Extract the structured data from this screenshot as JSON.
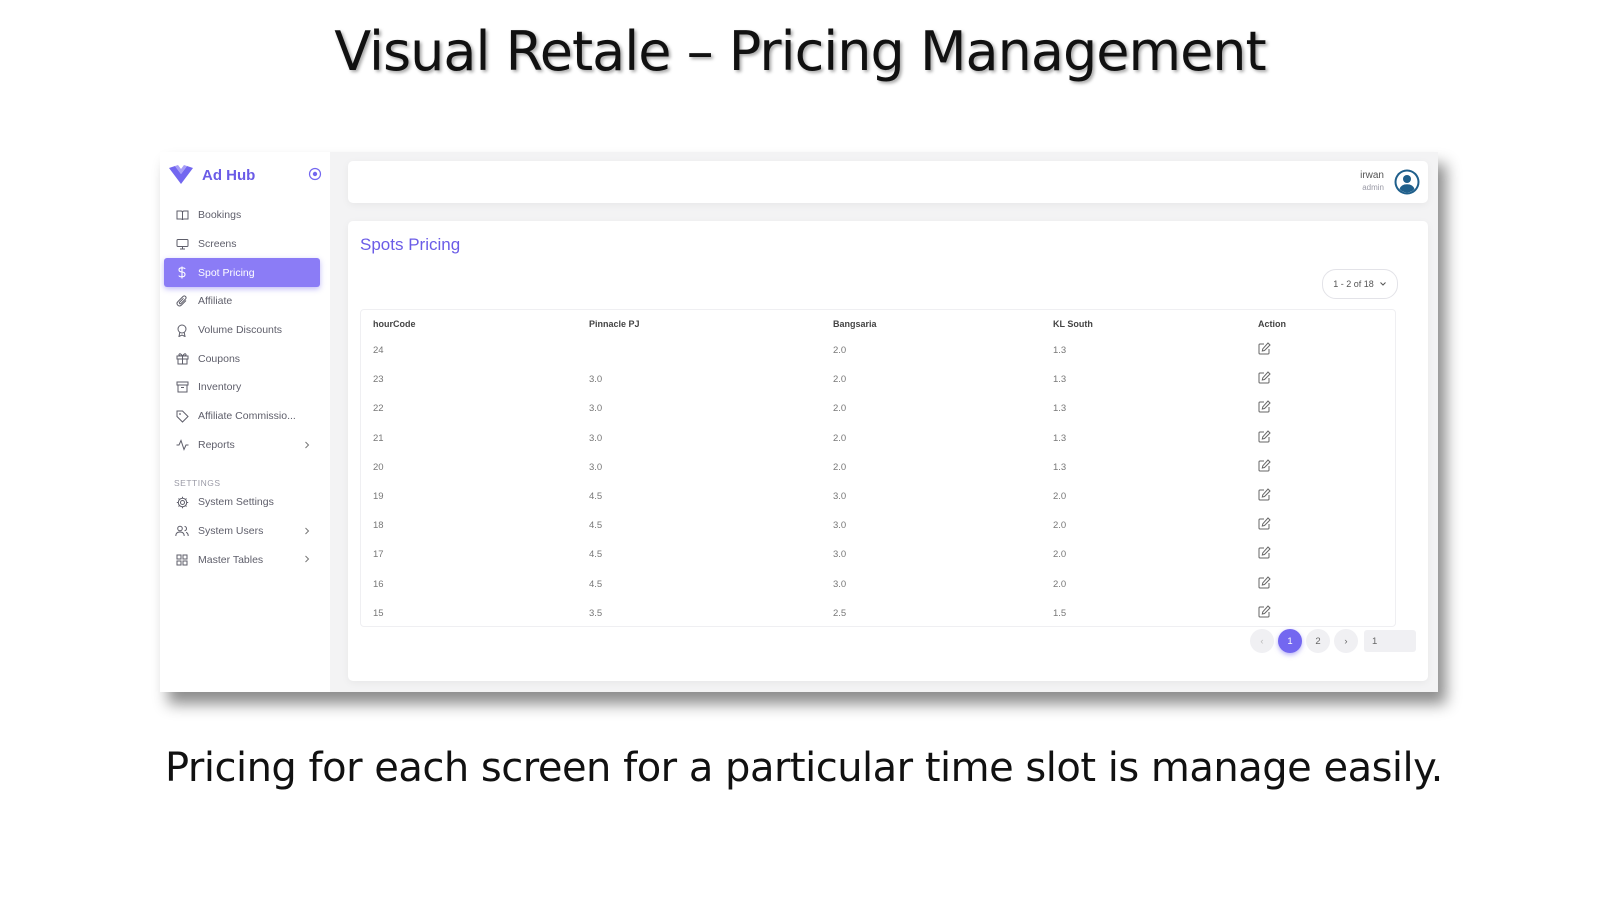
{
  "slide": {
    "title": "Visual Retale – Pricing Management",
    "caption": "Pricing for each screen for a particular time slot is manage easily."
  },
  "brand": {
    "name": "Ad Hub",
    "logo_icon": "heart-check-icon",
    "accent": "#7367f0"
  },
  "sidebar": {
    "items": [
      {
        "label": "Bookings",
        "icon": "book-open-icon"
      },
      {
        "label": "Screens",
        "icon": "monitor-icon"
      },
      {
        "label": "Spot Pricing",
        "icon": "dollar-icon",
        "active": true
      },
      {
        "label": "Affiliate",
        "icon": "paperclip-icon"
      },
      {
        "label": "Volume Discounts",
        "icon": "award-icon"
      },
      {
        "label": "Coupons",
        "icon": "gift-icon"
      },
      {
        "label": "Inventory",
        "icon": "archive-icon"
      },
      {
        "label": "Affiliate Commissio...",
        "icon": "tag-icon"
      },
      {
        "label": "Reports",
        "icon": "activity-icon",
        "has_submenu": true
      }
    ],
    "settings_label": "SETTINGS",
    "settings_items": [
      {
        "label": "System Settings",
        "icon": "gear-icon"
      },
      {
        "label": "System Users",
        "icon": "users-icon",
        "has_submenu": true
      },
      {
        "label": "Master Tables",
        "icon": "grid-icon",
        "has_submenu": true
      }
    ]
  },
  "header": {
    "user_name": "irwan",
    "user_role": "admin"
  },
  "main": {
    "title": "Spots Pricing",
    "range_select": "1 - 2 of 18",
    "table": {
      "columns": [
        "hourCode",
        "Pinnacle PJ",
        "Bangsaria",
        "KL South",
        "Action"
      ],
      "rows": [
        [
          "24",
          "",
          "2.0",
          "1.3"
        ],
        [
          "23",
          "3.0",
          "2.0",
          "1.3"
        ],
        [
          "22",
          "3.0",
          "2.0",
          "1.3"
        ],
        [
          "21",
          "3.0",
          "2.0",
          "1.3"
        ],
        [
          "20",
          "3.0",
          "2.0",
          "1.3"
        ],
        [
          "19",
          "4.5",
          "3.0",
          "2.0"
        ],
        [
          "18",
          "4.5",
          "3.0",
          "2.0"
        ],
        [
          "17",
          "4.5",
          "3.0",
          "2.0"
        ],
        [
          "16",
          "4.5",
          "3.0",
          "2.0"
        ],
        [
          "15",
          "3.5",
          "2.5",
          "1.5"
        ]
      ]
    },
    "pagination": {
      "prev": "‹",
      "pages": [
        "1",
        "2"
      ],
      "current": "1",
      "next": "›",
      "goto_value": "1"
    }
  }
}
